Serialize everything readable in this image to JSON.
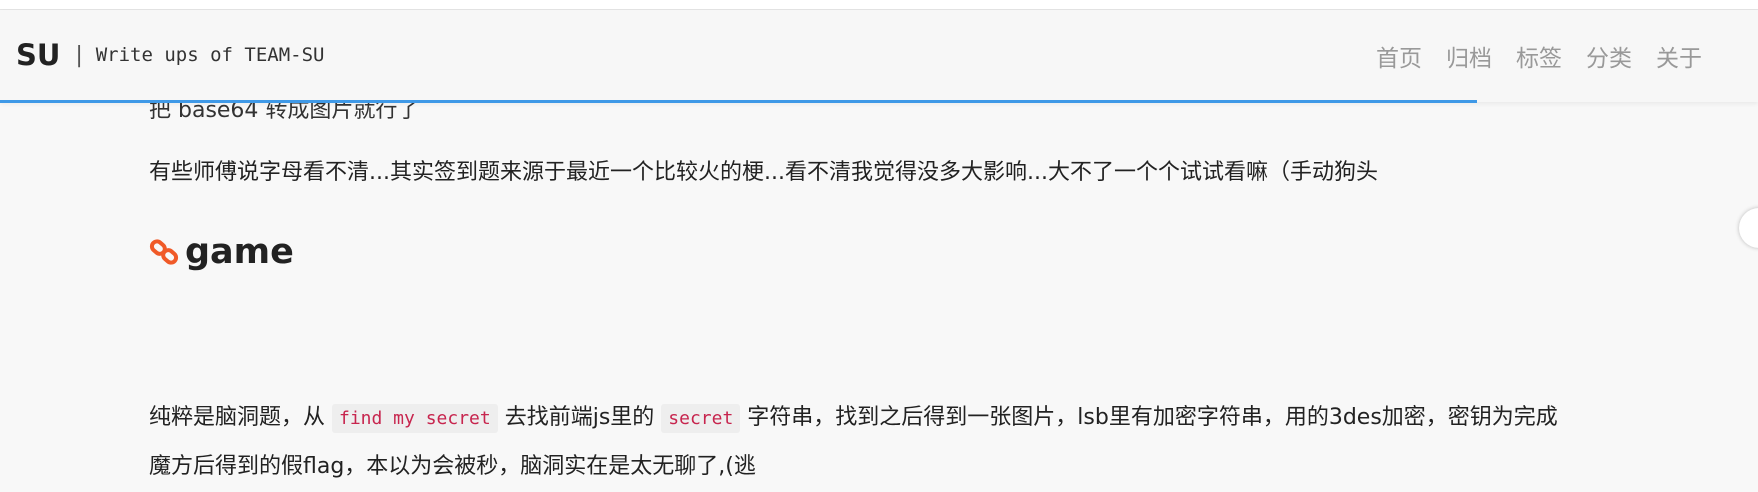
{
  "header": {
    "logo": "SU",
    "separator": "|",
    "subtitle": "Write ups of TEAM-SU",
    "nav": [
      "首页",
      "归档",
      "标签",
      "分类",
      "关于"
    ]
  },
  "reading_progress_percent": 84,
  "content": {
    "cut_line": "把 base64 转成图片就行了",
    "para1": "有些师傅说字母看不清...其实签到题来源于最近一个比较火的梗...看不清我觉得没多大影响...大不了一个个试试看嘛（手动狗头",
    "heading": "game",
    "para2": {
      "t1": "纯粹是脑洞题，从 ",
      "code1": "find my secret",
      "t2": " 去找前端js里的 ",
      "code2": "secret",
      "t3": " 字符串，找到之后得到一张图片，lsb里有加密字符串，用的3des加密，密钥为完成"
    },
    "para3": "魔方后得到的假flag，本以为会被秒，脑洞实在是太无聊了,(逃"
  },
  "colors": {
    "accent": "#3f99e7",
    "corner": "#5bc0eb",
    "link_icon": "#f05a28",
    "code_text": "#c7254e"
  }
}
